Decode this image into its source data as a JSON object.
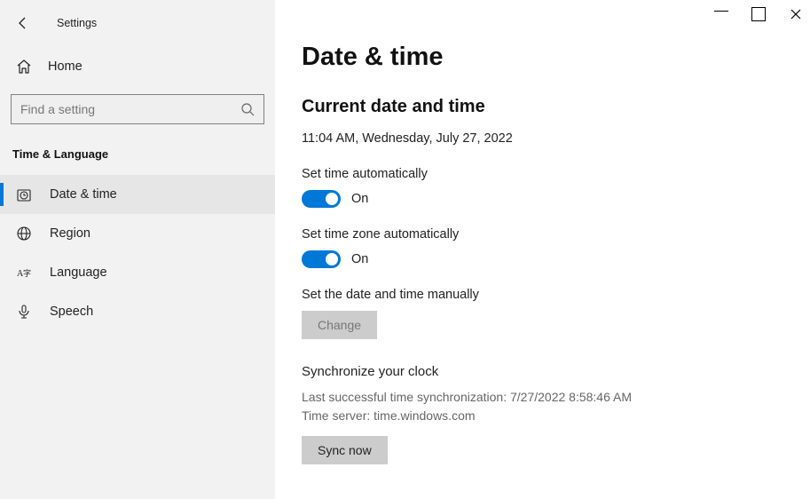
{
  "window": {
    "title": "Settings"
  },
  "sidebar": {
    "home_label": "Home",
    "search_placeholder": "Find a setting",
    "category_title": "Time & Language",
    "items": [
      {
        "label": "Date & time",
        "icon": "clock"
      },
      {
        "label": "Region",
        "icon": "globe"
      },
      {
        "label": "Language",
        "icon": "language"
      },
      {
        "label": "Speech",
        "icon": "mic"
      }
    ]
  },
  "main": {
    "page_title": "Date & time",
    "section_current_title": "Current date and time",
    "current_datetime": "11:04 AM, Wednesday, July 27, 2022",
    "set_time_auto_label": "Set time automatically",
    "set_time_auto_state": "On",
    "set_tz_auto_label": "Set time zone automatically",
    "set_tz_auto_state": "On",
    "set_manual_label": "Set the date and time manually",
    "change_button": "Change",
    "sync_title": "Synchronize your clock",
    "sync_last": "Last successful time synchronization: 7/27/2022 8:58:46 AM",
    "sync_server": "Time server: time.windows.com",
    "sync_button": "Sync now"
  }
}
